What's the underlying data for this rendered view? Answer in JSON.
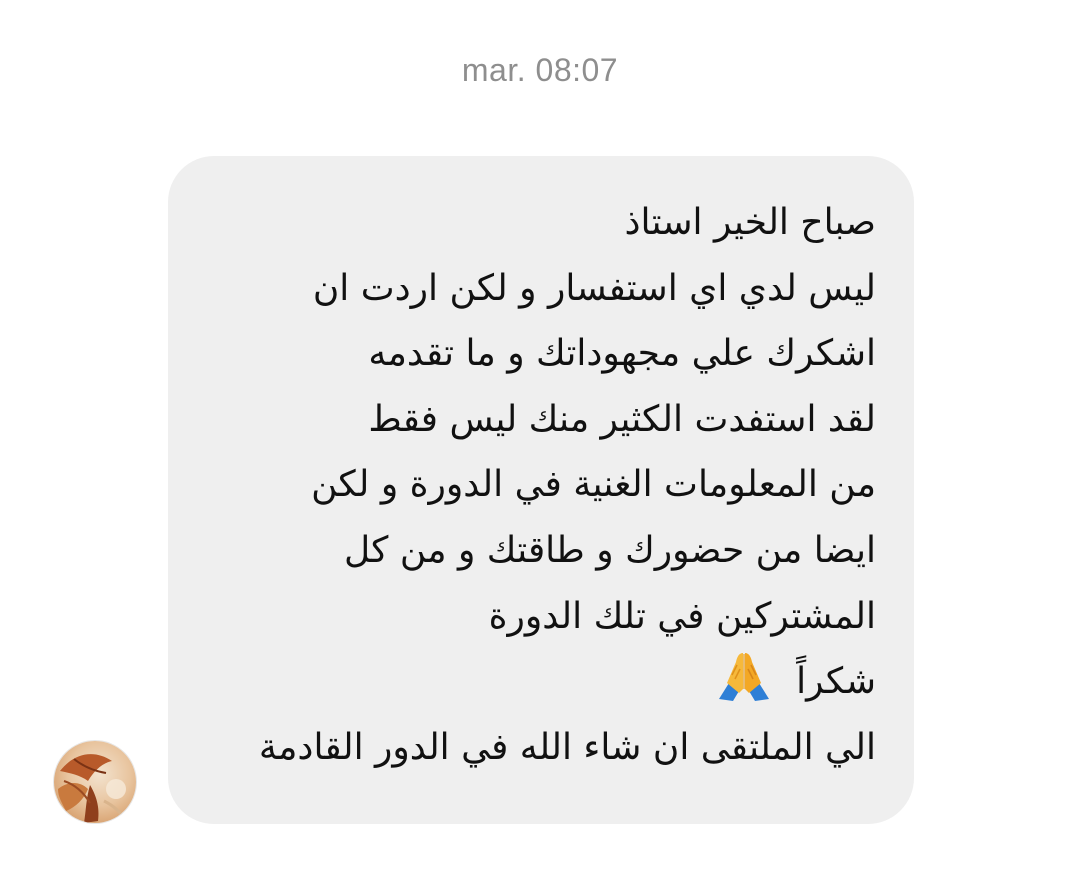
{
  "thread": {
    "timestamp": "mar. 08:07"
  },
  "message": {
    "lines": [
      "صباح الخير استاذ",
      "ليس لدي اي استفسار و لكن اردت ان",
      "اشكرك علي مجهوداتك و ما تقدمه",
      "لقد استفدت الكثير منك ليس فقط",
      "من المعلومات الغنية في الدورة و لكن",
      "ايضا من حضورك و طاقتك و من كل",
      "المشتركين في تلك الدورة",
      "شكراً",
      "الي الملتقى ان شاء الله في الدور القادمة"
    ],
    "emoji": "folded-hands-icon"
  },
  "sender": {
    "avatar": "avatar-photo"
  },
  "colors": {
    "bubble": "#efefef",
    "timestamp": "#8e8e8e",
    "text": "#111111",
    "background": "#ffffff"
  }
}
